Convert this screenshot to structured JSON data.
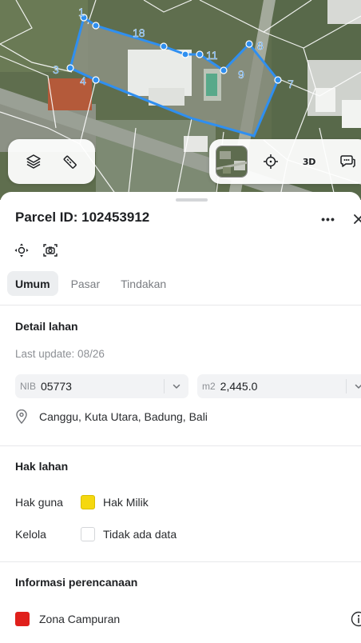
{
  "map": {
    "parcel_vertex_labels": [
      "1",
      "18",
      "11",
      "8",
      "9",
      "7",
      "3",
      "4"
    ],
    "parcel_color": "#2f8ff0",
    "controls": {
      "layers_button": "layers-icon",
      "measure_button": "ruler-icon",
      "satellite_toggle": "satellite-thumbnail",
      "locate_button": "crosshair-icon",
      "three_d_label": "3D",
      "feedback_button": "feedback-icon"
    }
  },
  "sheet": {
    "title": "Parcel ID: 102453912",
    "more_label": "•••",
    "tabs": [
      {
        "label": "Umum",
        "active": true
      },
      {
        "label": "Pasar",
        "active": false
      },
      {
        "label": "Tindakan",
        "active": false
      }
    ],
    "detail": {
      "title": "Detail lahan",
      "last_update": "Last update: 08/26",
      "nib_prefix": "NIB",
      "nib_value": "05773",
      "area_prefix": "m2",
      "area_value": "2,445.0",
      "address": "Canggu, Kuta Utara, Badung, Bali"
    },
    "rights": {
      "title": "Hak lahan",
      "hak_guna_label": "Hak guna",
      "hak_guna_value": "Hak Milik",
      "hak_guna_color": "#f5d80f",
      "kelola_label": "Kelola",
      "kelola_value": "Tidak ada data",
      "kelola_color": "#ffffff"
    },
    "planning": {
      "title": "Informasi perencanaan",
      "zone_value": "Zona Campuran",
      "zone_color": "#e0201b"
    }
  }
}
